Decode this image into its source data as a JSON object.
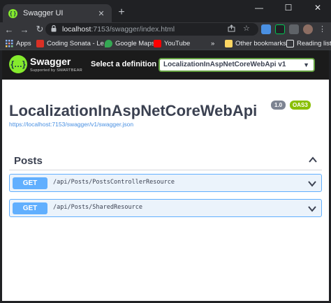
{
  "browser": {
    "tab_title": "Swagger UI",
    "tab_favicon_glyph": "{ }",
    "close_glyph": "✕",
    "new_tab_glyph": "+",
    "window_controls": [
      "—",
      "☐",
      "✕"
    ],
    "back_glyph": "←",
    "forward_glyph": "→",
    "reload_glyph": "↻",
    "url_host": "localhost",
    "url_path": ":7153/swagger/index.html",
    "more_glyph": "⋮"
  },
  "bookmarks": {
    "apps": "Apps",
    "items": [
      "Coding Sonata - Le...",
      "Google Maps",
      "YouTube"
    ],
    "overflow": "»",
    "other": "Other bookmarks",
    "reading_list": "Reading list"
  },
  "swagger": {
    "logo_glyph": "{…}",
    "logo_text": "Swagger",
    "logo_sub": "Supported by SMARTBEAR",
    "select_label": "Select a definition",
    "selected_definition": "LocalizationInAspNetCoreWebApi v1",
    "select_chevron": "▼"
  },
  "api": {
    "title": "LocalizationInAspNetCoreWebApi",
    "version": "1.0",
    "oas": "OAS3",
    "spec_url": "https://localhost:7153/swagger/v1/swagger.json"
  },
  "tag": {
    "name": "Posts"
  },
  "operations": [
    {
      "method": "GET",
      "path": "/api/Posts/PostsControllerResource"
    },
    {
      "method": "GET",
      "path": "/api/Posts/SharedResource"
    }
  ],
  "colors": {
    "get_method": "#61affe",
    "swagger_green": "#85ea2d",
    "topbar": "#1b1b1b"
  }
}
